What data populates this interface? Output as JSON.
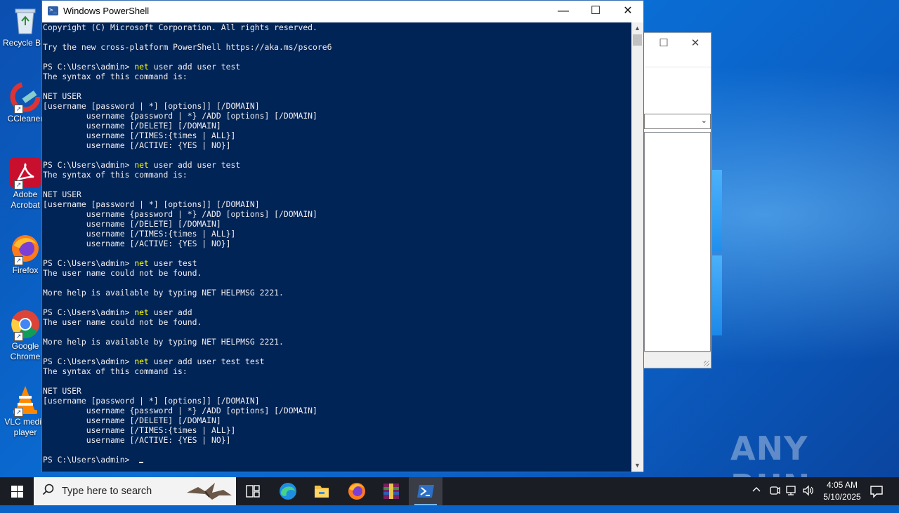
{
  "desktop": {
    "icons": [
      {
        "label": "Recycle Bin",
        "icon": "recycle-bin-icon"
      },
      {
        "label": "CCleaner",
        "icon": "ccleaner-icon"
      },
      {
        "label": "Adobe Acrobat",
        "icon": "adobe-acrobat-icon"
      },
      {
        "label": "Firefox",
        "icon": "firefox-icon"
      },
      {
        "label": "Google Chrome",
        "icon": "chrome-icon"
      },
      {
        "label": "VLC media player",
        "icon": "vlc-icon"
      }
    ],
    "watermark": "ANY RUN"
  },
  "powershell": {
    "title": "Windows PowerShell",
    "lines": [
      {
        "text": "Copyright (C) Microsoft Corporation. All rights reserved."
      },
      {
        "text": ""
      },
      {
        "text": "Try the new cross-platform PowerShell https://aka.ms/pscore6"
      },
      {
        "text": ""
      },
      {
        "prompt": "PS C:\\Users\\admin> ",
        "cmd": "net",
        "args": " user add user test"
      },
      {
        "text": "The syntax of this command is:"
      },
      {
        "text": ""
      },
      {
        "text": "NET USER"
      },
      {
        "text": "[username [password | *] [options]] [/DOMAIN]"
      },
      {
        "text": "         username {password | *} /ADD [options] [/DOMAIN]"
      },
      {
        "text": "         username [/DELETE] [/DOMAIN]"
      },
      {
        "text": "         username [/TIMES:{times | ALL}]"
      },
      {
        "text": "         username [/ACTIVE: {YES | NO}]"
      },
      {
        "text": ""
      },
      {
        "prompt": "PS C:\\Users\\admin> ",
        "cmd": "net",
        "args": " user add user test"
      },
      {
        "text": "The syntax of this command is:"
      },
      {
        "text": ""
      },
      {
        "text": "NET USER"
      },
      {
        "text": "[username [password | *] [options]] [/DOMAIN]"
      },
      {
        "text": "         username {password | *} /ADD [options] [/DOMAIN]"
      },
      {
        "text": "         username [/DELETE] [/DOMAIN]"
      },
      {
        "text": "         username [/TIMES:{times | ALL}]"
      },
      {
        "text": "         username [/ACTIVE: {YES | NO}]"
      },
      {
        "text": ""
      },
      {
        "prompt": "PS C:\\Users\\admin> ",
        "cmd": "net",
        "args": " user test"
      },
      {
        "text": "The user name could not be found."
      },
      {
        "text": ""
      },
      {
        "text": "More help is available by typing NET HELPMSG 2221."
      },
      {
        "text": ""
      },
      {
        "prompt": "PS C:\\Users\\admin> ",
        "cmd": "net",
        "args": " user add"
      },
      {
        "text": "The user name could not be found."
      },
      {
        "text": ""
      },
      {
        "text": "More help is available by typing NET HELPMSG 2221."
      },
      {
        "text": ""
      },
      {
        "prompt": "PS C:\\Users\\admin> ",
        "cmd": "net",
        "args": " user add user test test"
      },
      {
        "text": "The syntax of this command is:"
      },
      {
        "text": ""
      },
      {
        "text": "NET USER"
      },
      {
        "text": "[username [password | *] [options]] [/DOMAIN]"
      },
      {
        "text": "         username {password | *} /ADD [options] [/DOMAIN]"
      },
      {
        "text": "         username [/DELETE] [/DOMAIN]"
      },
      {
        "text": "         username [/TIMES:{times | ALL}]"
      },
      {
        "text": "         username [/ACTIVE: {YES | NO}]"
      },
      {
        "text": ""
      },
      {
        "prompt": "PS C:\\Users\\admin> ",
        "cursor": true
      }
    ]
  },
  "taskbar": {
    "search_placeholder": "Type here to search",
    "pinned": [
      "task-view-icon",
      "edge-icon",
      "file-explorer-icon",
      "firefox-icon",
      "winrar-icon",
      "powershell-icon"
    ],
    "clock_time": "4:05 AM",
    "clock_date": "5/10/2025"
  },
  "colors": {
    "console_bg": "#012456",
    "console_fg": "#eeedf0",
    "command": "#ffff00",
    "taskbar": "#1b1d24"
  }
}
